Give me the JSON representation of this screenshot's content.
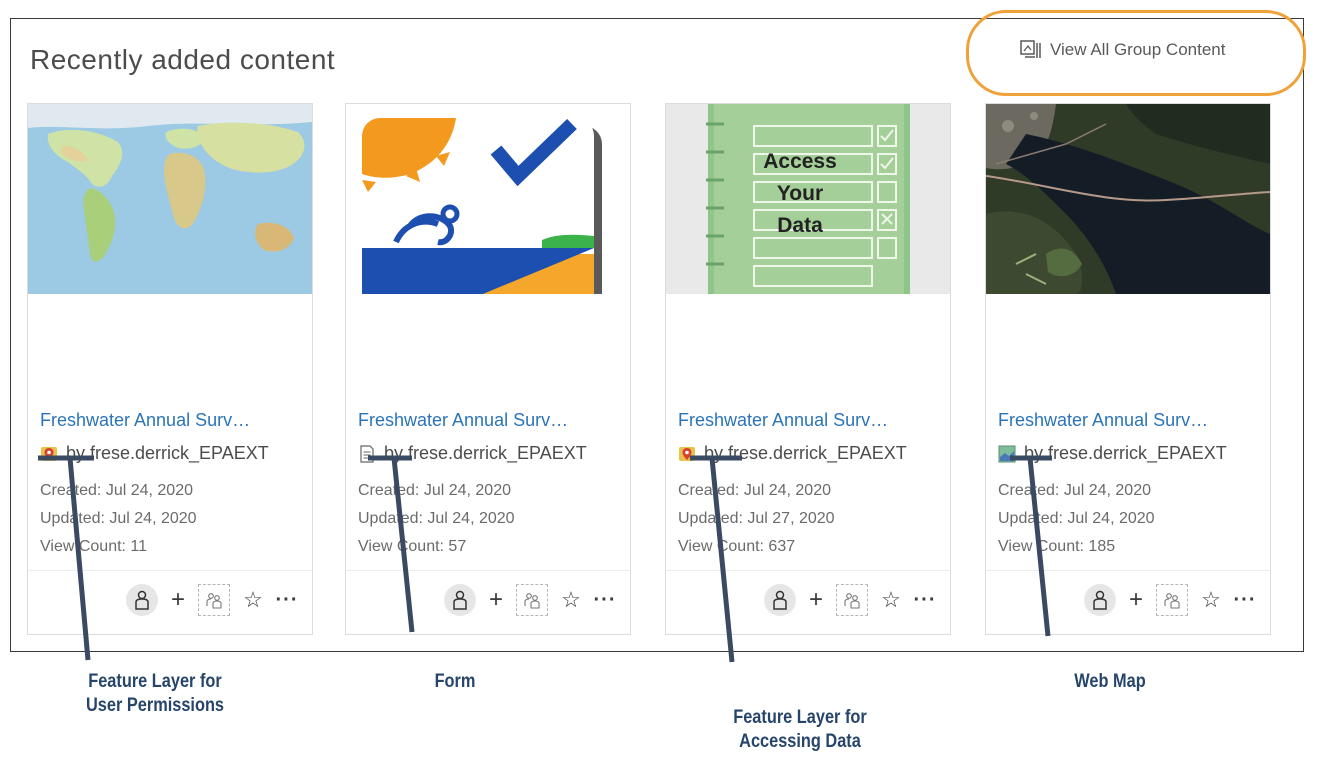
{
  "section": {
    "title": "Recently added content",
    "view_all_label": "View All Group Content"
  },
  "colors": {
    "link": "#2b74b8",
    "highlight": "#f0a23a",
    "callout": "#27456a"
  },
  "cards": [
    {
      "title": "Freshwater Annual Surv…",
      "type_icon": "feature-layer-icon",
      "owner": "by frese.derrick_EPAEXT",
      "created": "Created: Jul 24, 2020",
      "updated": "Updated: Jul 24, 2020",
      "views": "View Count: 11"
    },
    {
      "title": "Freshwater Annual Surv…",
      "type_icon": "form-icon",
      "owner": "by frese.derrick_EPAEXT",
      "created": "Created: Jul 24, 2020",
      "updated": "Updated: Jul 24, 2020",
      "views": "View Count: 57"
    },
    {
      "title": "Freshwater Annual Surv…",
      "type_icon": "feature-layer-icon",
      "owner": "by frese.derrick_EPAEXT",
      "created": "Created: Jul 24, 2020",
      "updated": "Updated: Jul 27, 2020",
      "views": "View Count: 637"
    },
    {
      "title": "Freshwater Annual Surv…",
      "type_icon": "web-map-icon",
      "owner": "by frese.derrick_EPAEXT",
      "created": "Created: Jul 24, 2020",
      "updated": "Updated: Jul 24, 2020",
      "views": "View Count: 185"
    }
  ],
  "thumbnails": {
    "access_data_text": [
      "Access",
      "Your",
      "Data"
    ]
  },
  "annotations": [
    {
      "line1": "Feature Layer for",
      "line2": "User Permissions"
    },
    {
      "line1": "Form",
      "line2": ""
    },
    {
      "line1": "Feature Layer for",
      "line2": "Accessing Data"
    },
    {
      "line1": "Web Map",
      "line2": ""
    }
  ]
}
